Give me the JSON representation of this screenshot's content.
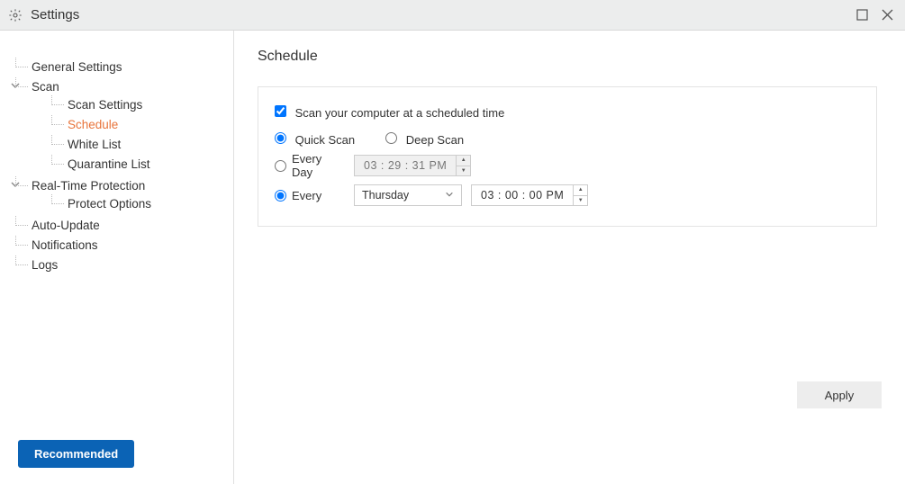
{
  "titlebar": {
    "title": "Settings"
  },
  "sidebar": {
    "items": {
      "general": "General Settings",
      "scan": "Scan",
      "scan_settings": "Scan Settings",
      "schedule": "Schedule",
      "whitelist": "White List",
      "quarantine": "Quarantine List",
      "rtp": "Real-Time Protection",
      "protect_options": "Protect Options",
      "auto_update": "Auto-Update",
      "notifications": "Notifications",
      "logs": "Logs"
    },
    "recommended": "Recommended"
  },
  "content": {
    "heading": "Schedule",
    "checkbox_label": "Scan your computer at a scheduled time",
    "quick_scan": "Quick Scan",
    "deep_scan": "Deep Scan",
    "every_day": "Every Day",
    "every": "Every",
    "day_selected": "Thursday",
    "time1": "03 : 29 : 31    PM",
    "time2": "03 : 00 : 00    PM",
    "apply": "Apply"
  }
}
